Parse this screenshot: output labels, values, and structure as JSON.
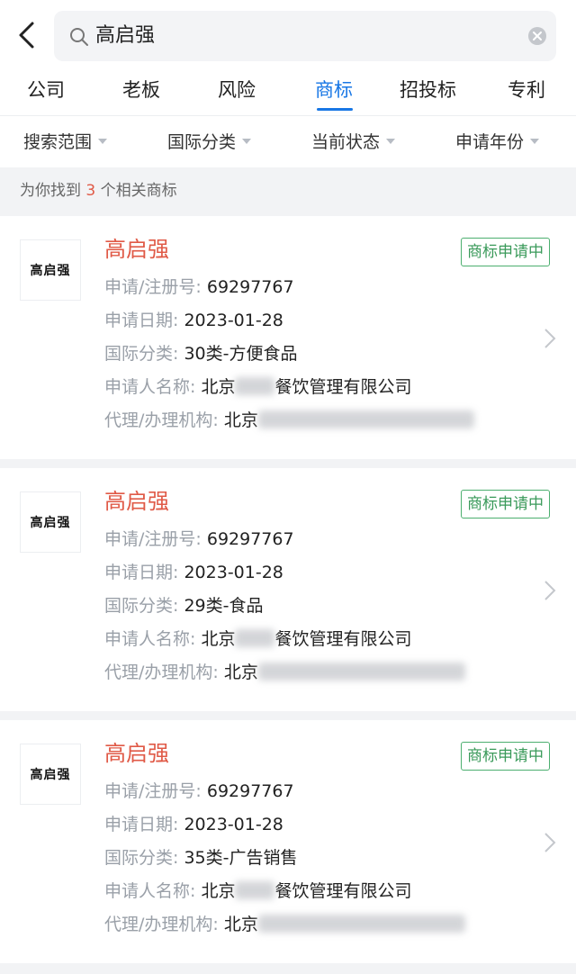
{
  "search": {
    "query": "高启强"
  },
  "tabs": [
    {
      "label": "公司"
    },
    {
      "label": "老板"
    },
    {
      "label": "风险"
    },
    {
      "label": "商标"
    },
    {
      "label": "招投标"
    },
    {
      "label": "专利"
    }
  ],
  "active_tab": "商标",
  "filters": [
    {
      "label": "搜索范围"
    },
    {
      "label": "国际分类"
    },
    {
      "label": "当前状态"
    },
    {
      "label": "申请年份"
    }
  ],
  "result_summary": {
    "prefix": "为你找到",
    "count": "3",
    "suffix": "个相关商标"
  },
  "labels": {
    "reg_no": "申请/注册号",
    "date": "申请日期",
    "category": "国际分类",
    "applicant": "申请人名称",
    "agency": "代理/办理机构",
    "colon": ": "
  },
  "results": [
    {
      "logo_text": "高启强",
      "name": "高启强",
      "status": "商标申请中",
      "reg_no": "69297767",
      "date": "2023-01-28",
      "category": "30类-方便食品",
      "applicant_start": "北京",
      "applicant_end": "餐饮管理有限公司",
      "agency_start": "北京"
    },
    {
      "logo_text": "高启强",
      "name": "高启强",
      "status": "商标申请中",
      "reg_no": "69297767",
      "date": "2023-01-28",
      "category": "29类-食品",
      "applicant_start": "北京",
      "applicant_end": "餐饮管理有限公司",
      "agency_start": "北京"
    },
    {
      "logo_text": "高启强",
      "name": "高启强",
      "status": "商标申请中",
      "reg_no": "69297767",
      "date": "2023-01-28",
      "category": "35类-广告销售",
      "applicant_start": "北京",
      "applicant_end": "餐饮管理有限公司",
      "agency_start": "北京"
    }
  ],
  "colors": {
    "accent": "#1877e5",
    "highlight": "#e05a47",
    "status_green": "#3a9a5a"
  }
}
